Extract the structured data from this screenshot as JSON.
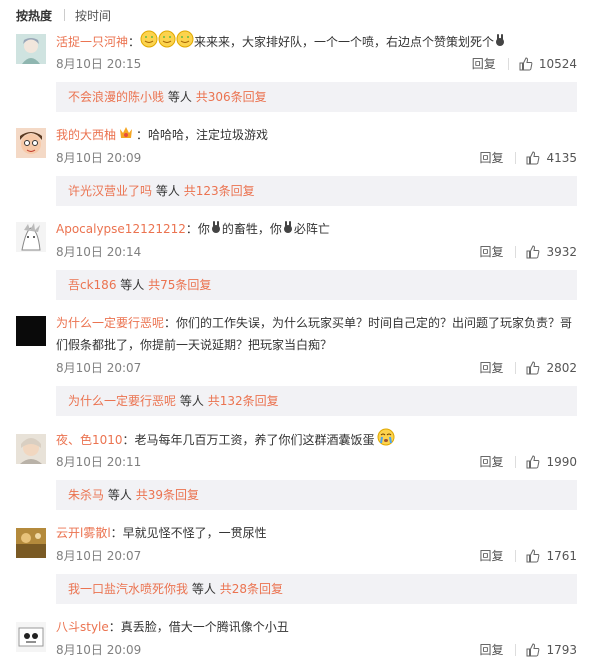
{
  "tabs": {
    "hot": "按热度",
    "time": "按时间"
  },
  "reply_label": "回复",
  "replies_mid": "等人",
  "comments": [
    {
      "user": "活捉一只河神",
      "text_before": "：",
      "text_after": "来来来，大家排好队，一个一个喷，右边点个赞策划死个",
      "emoji": "smile-emoji x3",
      "icon_at_end": "rabbit-emoji",
      "time": "8月10日 20:15",
      "likes": "10524",
      "reply_user": "不会浪漫的陈小贱",
      "reply_count": "共306条回复"
    },
    {
      "user": "我的大西柚",
      "text": "：哈哈哈，注定垃圾游戏",
      "badge": "vip-badge",
      "time": "8月10日 20:09",
      "likes": "4135",
      "reply_user": "许光汉营业了吗",
      "reply_count": "共123条回复"
    },
    {
      "user": "Apocalypse12121212",
      "text_a": "：你",
      "text_b": "的畜牲，你",
      "text_c": "必阵亡",
      "time": "8月10日 20:14",
      "likes": "3932",
      "reply_user": "吾ck186",
      "reply_count": "共75条回复"
    },
    {
      "user": "为什么一定要行恶呢",
      "text": "：你们的工作失误，为什么玩家买单？时间自己定的？出问题了玩家负责？哥们假条都批了，你提前一天说延期？把玩家当白痴？",
      "time": "8月10日 20:07",
      "likes": "2802",
      "reply_user": "为什么一定要行恶呢",
      "reply_count": "共132条回复"
    },
    {
      "user": "夜、色1010",
      "text": "：老马每年几百万工资，养了你们这群酒囊饭蛋",
      "time": "8月10日 20:11",
      "likes": "1990",
      "reply_user": "朱杀马",
      "reply_count": "共39条回复"
    },
    {
      "user": "云开l雾散l",
      "text": "：早就见怪不怪了，一贯尿性",
      "time": "8月10日 20:07",
      "likes": "1761",
      "reply_user": "我一口盐汽水喷死你我",
      "reply_count": "共28条回复"
    },
    {
      "user": "八斗style",
      "text": "：真丢脸，借大一个腾讯像个小丑",
      "time": "8月10日 20:09",
      "likes": "1793"
    }
  ],
  "colors": {
    "link": "#eb7350",
    "replies_bg": "#f2f2f5",
    "time": "#808080"
  }
}
